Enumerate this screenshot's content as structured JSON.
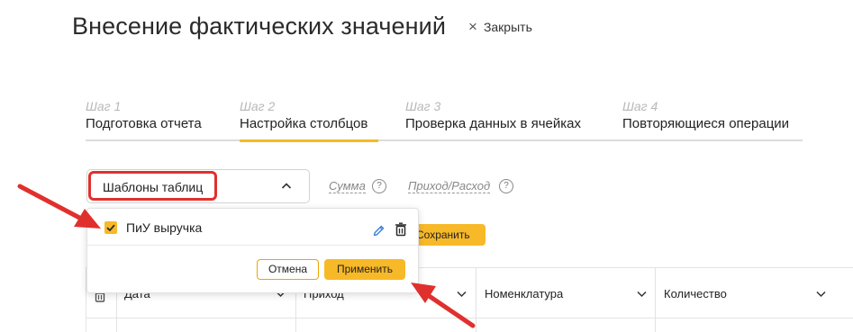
{
  "header": {
    "title": "Внесение фактических значений",
    "close_icon": "×",
    "close_label": "Закрыть"
  },
  "steps": [
    {
      "num": "Шаг 1",
      "name": "Подготовка отчета",
      "active": false
    },
    {
      "num": "Шаг 2",
      "name": "Настройка столбцов",
      "active": true
    },
    {
      "num": "Шаг 3",
      "name": "Проверка данных в ячейках",
      "active": false
    },
    {
      "num": "Шаг 4",
      "name": "Повторяющиеся операции",
      "active": false
    }
  ],
  "toolbar": {
    "template_select_label": "Шаблоны таблиц",
    "sum_link": "Сумма",
    "help_glyph": "?",
    "income_expense_link": "Приход/Расход",
    "save_label": "Сохранить"
  },
  "dropdown": {
    "item_label": "ПиУ выручка",
    "item_checked": true,
    "cancel_label": "Отмена",
    "apply_label": "Применить"
  },
  "table": {
    "columns": [
      "Дата",
      "Приход",
      "Номенклатура",
      "Количество"
    ]
  },
  "colors": {
    "accent": "#f7b928",
    "annotation": "#e0302e"
  },
  "icons": {
    "close": "close-icon",
    "select_toggle": "chevron-up-icon",
    "help": "help-icon",
    "checkbox": "checkbox-checked-icon",
    "edit": "pencil-icon",
    "delete": "trash-icon",
    "column_menu": "chevron-down-icon"
  }
}
